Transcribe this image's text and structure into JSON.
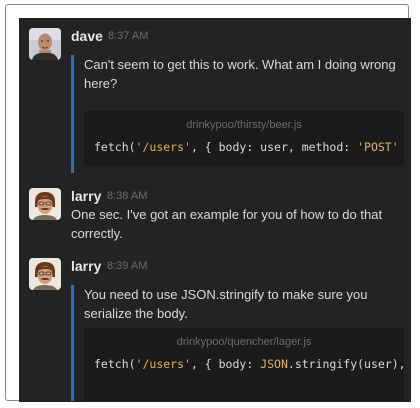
{
  "messages": [
    {
      "author": "dave",
      "time": "8:37 AM",
      "text": "Can't seem to get this to work. What am I doing wrong here?",
      "snippet": {
        "file": "drinkypoo/thirsty/beer.js",
        "code": {
          "p1": "fetch(",
          "s1": "'/users'",
          "p2": ", { body: user, method: ",
          "s2": "'POST'",
          "p3": " })"
        }
      }
    },
    {
      "author": "larry",
      "time": "8:38 AM",
      "text": "One sec. I've got an example for you of how to do that correctly."
    },
    {
      "author": "larry",
      "time": "8:39 AM",
      "text": "You need to use JSON.stringify to make sure you serialize the body.",
      "snippet": {
        "file": "drinkypoo/quencher/lager.js",
        "code": {
          "p1": "fetch(",
          "s1": "'/users'",
          "p2": ", { body: ",
          "k1": "JSON",
          "p3": ".stringify(user), m"
        }
      }
    }
  ],
  "colors": {
    "background": "#232323",
    "quote_bar": "#2f6fc1",
    "string": "#e0b25a"
  }
}
